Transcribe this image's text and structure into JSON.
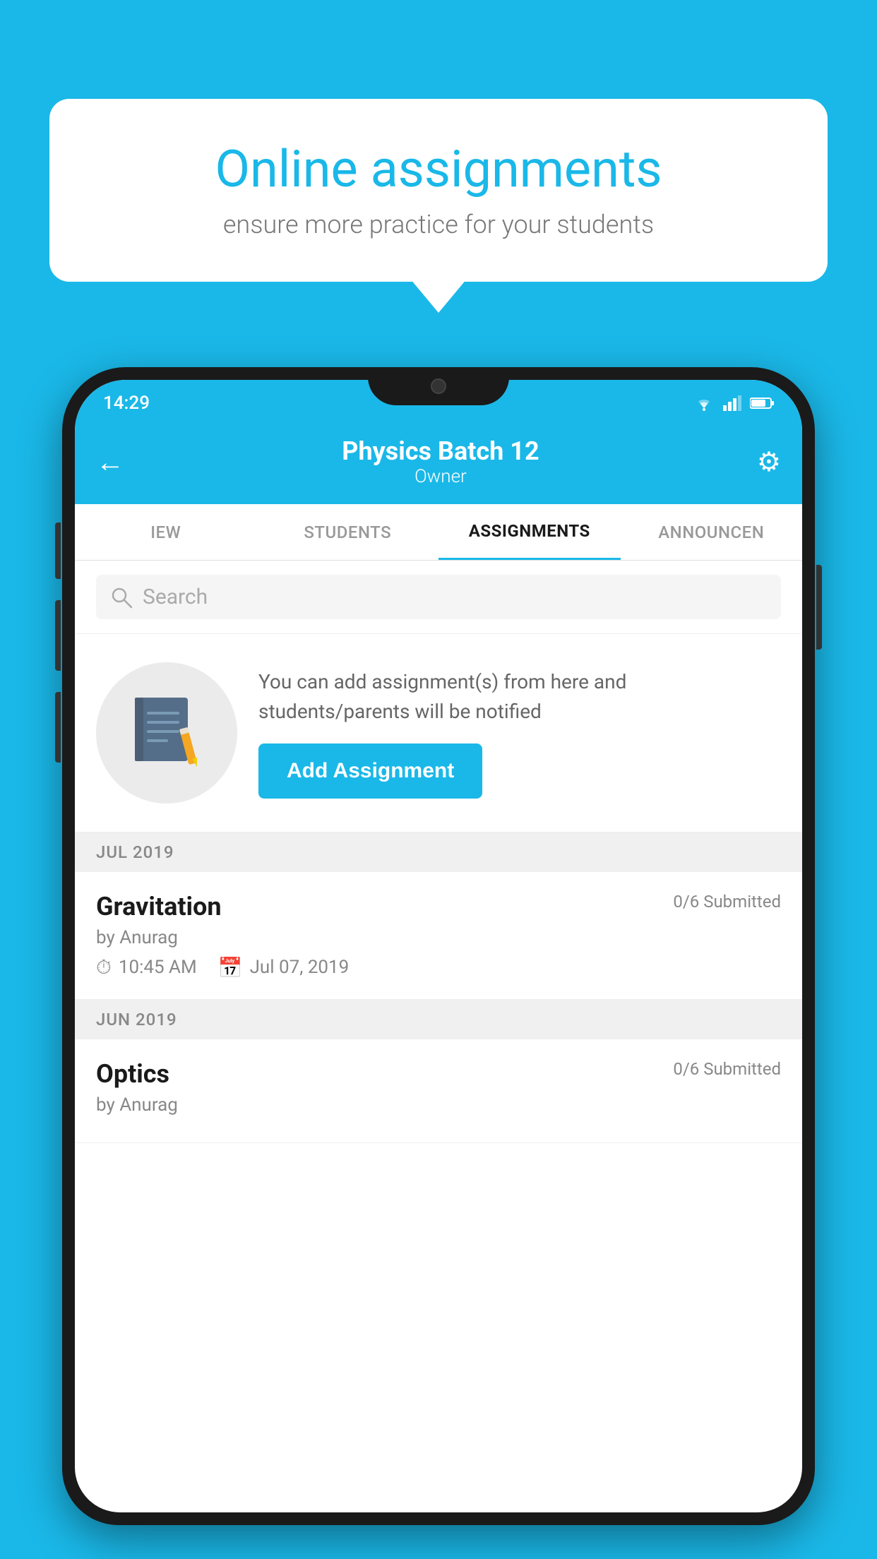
{
  "background_color": "#1ab8e8",
  "speech_bubble": {
    "title": "Online assignments",
    "subtitle": "ensure more practice for your students"
  },
  "phone": {
    "status_bar": {
      "time": "14:29",
      "wifi": "wifi",
      "signal": "signal",
      "battery": "battery"
    },
    "header": {
      "back_label": "←",
      "title": "Physics Batch 12",
      "subtitle": "Owner",
      "settings_icon": "⚙"
    },
    "tabs": [
      {
        "label": "IEW",
        "active": false
      },
      {
        "label": "STUDENTS",
        "active": false
      },
      {
        "label": "ASSIGNMENTS",
        "active": true
      },
      {
        "label": "ANNOUNCEN",
        "active": false
      }
    ],
    "search": {
      "placeholder": "Search"
    },
    "add_assignment": {
      "description": "You can add assignment(s) from here and students/parents will be notified",
      "button_label": "Add Assignment"
    },
    "sections": [
      {
        "month_label": "JUL 2019",
        "assignments": [
          {
            "title": "Gravitation",
            "submitted": "0/6 Submitted",
            "by": "by Anurag",
            "time": "10:45 AM",
            "date": "Jul 07, 2019"
          }
        ]
      },
      {
        "month_label": "JUN 2019",
        "assignments": [
          {
            "title": "Optics",
            "submitted": "0/6 Submitted",
            "by": "by Anurag",
            "time": "",
            "date": ""
          }
        ]
      }
    ]
  }
}
